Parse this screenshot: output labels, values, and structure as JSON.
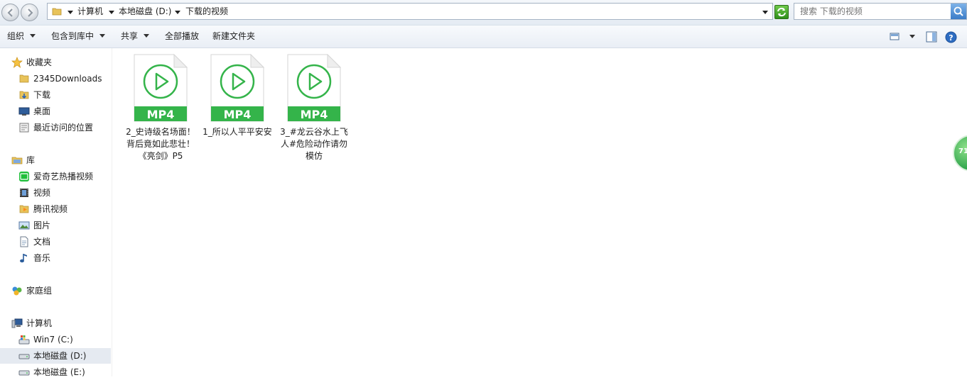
{
  "address_bar": {
    "crumbs": [
      "计算机",
      "本地磁盘 (D:)",
      "下载的视频"
    ],
    "search_placeholder": "搜索 下载的视频"
  },
  "toolbar": {
    "organize": "组织",
    "include_in_library": "包含到库中",
    "share": "共享",
    "play_all": "全部播放",
    "new_folder": "新建文件夹"
  },
  "nav": {
    "favorites": {
      "label": "收藏夹",
      "items": [
        {
          "label": "2345Downloads",
          "icon": "folder-icon"
        },
        {
          "label": "下载",
          "icon": "downloads-folder-icon"
        },
        {
          "label": "桌面",
          "icon": "desktop-icon"
        },
        {
          "label": "最近访问的位置",
          "icon": "recent-places-icon"
        }
      ]
    },
    "libraries": {
      "label": "库",
      "items": [
        {
          "label": "爱奇艺热播视频",
          "icon": "iqiyi-icon"
        },
        {
          "label": "视频",
          "icon": "video-library-icon"
        },
        {
          "label": "腾讯视频",
          "icon": "tencent-video-icon"
        },
        {
          "label": "图片",
          "icon": "pictures-library-icon"
        },
        {
          "label": "文档",
          "icon": "documents-library-icon"
        },
        {
          "label": "音乐",
          "icon": "music-library-icon"
        }
      ]
    },
    "homegroup": {
      "label": "家庭组"
    },
    "computer": {
      "label": "计算机",
      "items": [
        {
          "label": "Win7 (C:)",
          "icon": "system-drive-icon"
        },
        {
          "label": "本地磁盘 (D:)",
          "icon": "drive-icon",
          "selected": true
        },
        {
          "label": "本地磁盘 (E:)",
          "icon": "drive-icon"
        }
      ]
    }
  },
  "files": [
    {
      "name": "2_史诗级名场面！背后竟如此悲壮！《亮剑》P5",
      "type_label": "MP4",
      "icon": "mp4-file-icon"
    },
    {
      "name": "1_所以人平平安安",
      "type_label": "MP4",
      "icon": "mp4-file-icon"
    },
    {
      "name": "3_#龙云谷水上飞人#危险动作请勿模仿",
      "type_label": "MP4",
      "icon": "mp4-file-icon"
    }
  ],
  "side_widget": {
    "text": "71"
  },
  "colors": {
    "mp4_green": "#34b44a",
    "selection": "#e5eaf1"
  }
}
